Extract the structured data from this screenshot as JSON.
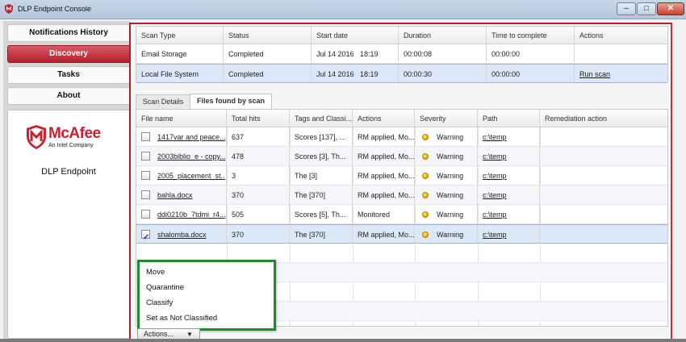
{
  "window": {
    "title": "DLP Endpoint Console",
    "controls": {
      "minimize": "–",
      "maximize": "□",
      "close": "✕"
    }
  },
  "sidebar": {
    "items": [
      {
        "label": "Notifications History",
        "active": false
      },
      {
        "label": "Discovery",
        "active": true
      },
      {
        "label": "Tasks",
        "active": false
      },
      {
        "label": "About",
        "active": false
      }
    ],
    "brand": {
      "logo_text": "McAfee",
      "logo_subtitle": "An Intel Company",
      "product": "DLP Endpoint",
      "logo_color": "#cc1f2f"
    }
  },
  "scans": {
    "columns": [
      "Scan Type",
      "Status",
      "Start date",
      "Duration",
      "Time to complete",
      "Actions"
    ],
    "rows": [
      {
        "scan_type": "Email Storage",
        "status": "Completed",
        "start_date": "Jul 14 2016   18:19",
        "duration": "00:00:08",
        "time_to_complete": "00:00:00",
        "action": ""
      },
      {
        "scan_type": "Local File System",
        "status": "Completed",
        "start_date": "Jul 14 2016   18:19",
        "duration": "00:00:30",
        "time_to_complete": "00:00:00",
        "action": "Run scan"
      }
    ]
  },
  "tabs": [
    {
      "label": "Scan Details",
      "active": false
    },
    {
      "label": "Files found by scan",
      "active": true
    }
  ],
  "files": {
    "columns": [
      "File name",
      "Total hits",
      "Tags and Classi...",
      "Actions",
      "Severity",
      "Path",
      "Remediation action"
    ],
    "rows": [
      {
        "checked": false,
        "name": "1417var and peace...",
        "hits": "637",
        "tags": "Scores [137], ...",
        "actions": "RM applied, Mo...",
        "severity": "Warning",
        "path": "c:\\temp",
        "remediation": ""
      },
      {
        "checked": false,
        "name": "2003biblio_e - copy...",
        "hits": "478",
        "tags": "Scores [3], Th...",
        "actions": "RM applied, Mo...",
        "severity": "Warning",
        "path": "c:\\temp",
        "remediation": ""
      },
      {
        "checked": false,
        "name": "2005_placement_st...",
        "hits": "3",
        "tags": "The [3]",
        "actions": "RM applied, Mo...",
        "severity": "Warning",
        "path": "c:\\temp",
        "remediation": ""
      },
      {
        "checked": false,
        "name": "bahla.docx",
        "hits": "370",
        "tags": "The [370]",
        "actions": "RM applied, Mo...",
        "severity": "Warning",
        "path": "c:\\temp",
        "remediation": ""
      },
      {
        "checked": false,
        "name": "ddi0210b_7tdmi_r4...",
        "hits": "505",
        "tags": "Scores [5], Th...",
        "actions": "Monitored",
        "severity": "Warning",
        "path": "c:\\temp",
        "remediation": ""
      },
      {
        "checked": true,
        "name": "shalomba.docx",
        "hits": "370",
        "tags": "The [370]",
        "actions": "RM applied, Mo...",
        "severity": "Warning",
        "path": "c:\\temp",
        "remediation": ""
      }
    ]
  },
  "context_menu": {
    "items": [
      "Move",
      "Quarantine",
      "Classify",
      "Set as Not Classified"
    ],
    "border_color": "#1d8a2f"
  },
  "actions_button": {
    "label": "Actions...",
    "arrow": "▼"
  },
  "colors": {
    "accent_red": "#b61c2e",
    "selected_row": "#dce8f8",
    "warning_dot": "#e0a800"
  }
}
